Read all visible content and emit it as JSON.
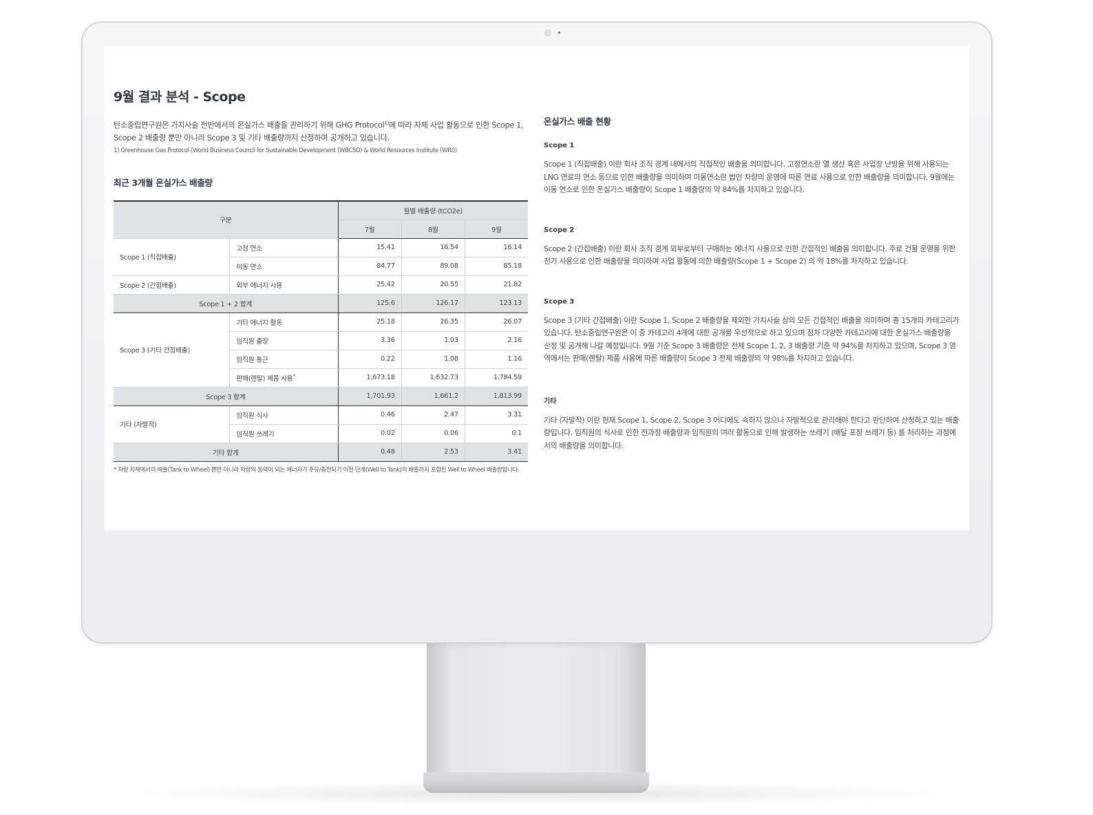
{
  "left": {
    "title": "9월 결과 분석 - Scope",
    "intro_1": "탄소중립연구원은 가치사슬 전반에서의 온실가스 배출을 관리하기 위해 GHG Protocol",
    "intro_sup": "1)",
    "intro_2": "에 따라 자체 사업 활동으로 인한 Scope 1, Scope 2 배출량 뿐만 아니라 Scope 3 및 기타 배출량까지 산정하여 공개하고 있습니다.",
    "footnote": "1) Greenhouse Gas Protocol (World Business Council for Sustainable Development (WBCSD) & World Resources Institute (WRI))",
    "table_title": "최근 3개월 온실가스 배출량"
  },
  "table": {
    "header": {
      "category": "구분",
      "monthly": "월별 배출량 (tCO2e)",
      "months": [
        "7월",
        "8월",
        "9월"
      ]
    },
    "scope1": {
      "label": "Scope 1 (직접배출)",
      "rows": [
        {
          "item": "고정 연소",
          "values": [
            "15.41",
            "16.54",
            "16.14"
          ]
        },
        {
          "item": "이동 연소",
          "values": [
            "84.77",
            "89.08",
            "85.18"
          ]
        }
      ]
    },
    "scope2": {
      "label": "Scope 2 (간접배출)",
      "rows": [
        {
          "item": "외부 에너지 사용",
          "values": [
            "25.42",
            "20.55",
            "21.82"
          ]
        }
      ]
    },
    "sum12": {
      "label": "Scope 1 + 2 합계",
      "values": [
        "125.6",
        "126.17",
        "123.13"
      ]
    },
    "scope3": {
      "label": "Scope 3 (기타 간접배출)",
      "rows": [
        {
          "item": "기타 에너지 활동",
          "values": [
            "25.18",
            "26.35",
            "26.07"
          ]
        },
        {
          "item": "임직원 출장",
          "values": [
            "3.36",
            "1.03",
            "2.16"
          ]
        },
        {
          "item": "임직원 통근",
          "values": [
            "0.22",
            "1.08",
            "1.16"
          ]
        },
        {
          "item": "판매(렌탈) 제품 사용",
          "mark": "*",
          "values": [
            "1,673.18",
            "1,632.73",
            "1,784.59"
          ]
        }
      ]
    },
    "sum3": {
      "label": "Scope 3 합계",
      "values": [
        "1,701.93",
        "1,661.2",
        "1,813.99"
      ]
    },
    "other": {
      "label": "기타 (자발적)",
      "rows": [
        {
          "item": "임직원 식사",
          "values": [
            "0.46",
            "2.47",
            "3.31"
          ]
        },
        {
          "item": "임직원 쓰레기",
          "values": [
            "0.02",
            "0.06",
            "0.1"
          ]
        }
      ]
    },
    "sum_other": {
      "label": "기타 합계",
      "values": [
        "0.48",
        "2.53",
        "3.41"
      ]
    },
    "note": "* 차량 자체에서의 배출(Tank to Wheel) 뿐만 아니라 차량의 동력이 되는 에너지가 주유/충전되기 이전 단계(Well to Tank)의 배출까지 포함된 Well to Wheel 배출량입니다."
  },
  "right": {
    "title": "온실가스 배출 현황",
    "sections": [
      {
        "head": "Scope 1",
        "text": "Scope 1 (직접배출) 이란 회사 조직 경계 내에서의 직접적인 배출을 의미합니다. 고정연소란 열 생산 혹은 사업장 난방을 위해 사용되는 LNG 연료의 연소 등으로 인한 배출량을 의미하며 이동연소란 법인 차량의 운영에 따른 연료 사용으로 인한 배출량을 의미합니다. 9월에는 이동 연소로 인한 온실가스 배출량이 Scope 1 배출량의 약 84%를 차지하고 있습니다."
      },
      {
        "head": "Scope 2",
        "text": "Scope 2 (간접배출) 이란 회사 조직 경계 외부로부터 구매하는 에너지 사용으로 인한 간접적인 배출을 의미합니다. 주로 건물 운영을 위한 전기 사용으로 인한 배출량을 의미하며 사업 활동에 의한 배출량(Scope 1 + Scope 2) 의 약 18%를 차지하고 있습니다."
      },
      {
        "head": "Scope 3",
        "text": "Scope 3 (기타 간접배출) 이란 Scope 1, Scope 2 배출량을 제외한 가치사슬 상의 모든 간접적인 배출을 의미하며 총 15개의 카테고리가 있습니다. 탄소중립연구원은 이 중 카테고리 4개에 대한 공개를 우선적으로 하고 있으며 점차 다양한 카테고리에 대한 온실가스 배출량을 산정 및 공개해 나갈 예정입니다. 9월 기준 Scope 3 배출량은 전체 Scope 1, 2, 3 배출량 기준 약 94%를 차지하고 있으며, Scope 3 영역에서는 판매(렌탈) 제품 사용에 따른 배출량이 Scope 3 전체 배출량의 약 98%를 차지하고 있습니다."
      },
      {
        "head": "기타",
        "text": "기타 (자발적) 이란 현재 Scope 1, Scope 2, Scope 3 어디에도 속하지 않으나 자발적으로 관리해야 한다고 판단하여 산정하고 있는 배출량입니다. 임직원의 식사로 인한 전과정 배출량과 임직원의 여러 활동으로 인해 발생하는 쓰레기 (배달 포장 쓰레기 등) 를 처리하는 과정에서의 배출량을 의미합니다."
      }
    ]
  }
}
